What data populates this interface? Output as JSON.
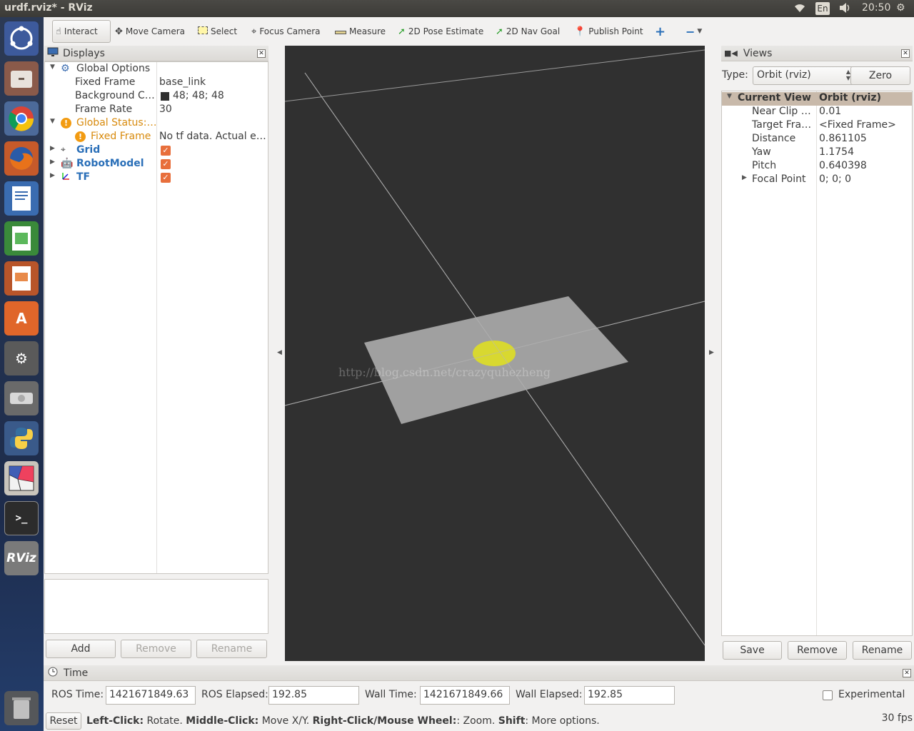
{
  "window": {
    "title": "urdf.rviz* - RViz"
  },
  "system_tray": {
    "language": "En",
    "clock": "20:50"
  },
  "launcher": {
    "items": [
      "ubuntu-logo",
      "files",
      "chrome",
      "firefox",
      "writer",
      "calc",
      "impress",
      "software-center",
      "system-settings",
      "disk",
      "python",
      "app",
      "terminal",
      "rviz",
      "trash"
    ],
    "rviz_label": "RViz"
  },
  "toolbar": {
    "tools": [
      {
        "label": "Interact",
        "icon": "hand-icon"
      },
      {
        "label": "Move Camera",
        "icon": "move-icon"
      },
      {
        "label": "Select",
        "icon": "select-icon"
      },
      {
        "label": "Focus Camera",
        "icon": "focus-icon"
      },
      {
        "label": "Measure",
        "icon": "ruler-icon"
      },
      {
        "label": "2D Pose Estimate",
        "icon": "green-arrow-icon"
      },
      {
        "label": "2D Nav Goal",
        "icon": "green-arrow-icon"
      },
      {
        "label": "Publish Point",
        "icon": "pin-icon"
      }
    ]
  },
  "displays": {
    "title": "Displays",
    "global_options": {
      "label": "Global Options",
      "fixed_frame_label": "Fixed Frame",
      "fixed_frame_value": "base_link",
      "background_label": "Background C…",
      "background_value": "48; 48; 48",
      "frame_rate_label": "Frame Rate",
      "frame_rate_value": "30"
    },
    "global_status": {
      "label": "Global Status:…",
      "fixed_frame_label": "Fixed Frame",
      "fixed_frame_value": "No tf data.  Actual e…"
    },
    "items": [
      {
        "label": "Grid",
        "checked": true
      },
      {
        "label": "RobotModel",
        "checked": true
      },
      {
        "label": "TF",
        "checked": true
      }
    ],
    "buttons": {
      "add": "Add",
      "remove": "Remove",
      "rename": "Rename"
    }
  },
  "viewport": {
    "background_color": "#303030",
    "watermark": "http://blog.csdn.net/crazyquhezheng"
  },
  "views": {
    "title": "Views",
    "type_label": "Type:",
    "type_value": "Orbit (rviz)",
    "zero_button": "Zero",
    "header_name": "Current View",
    "header_value": "Orbit (rviz)",
    "props": [
      {
        "name": "Near Clip …",
        "value": "0.01"
      },
      {
        "name": "Target Fra…",
        "value": "<Fixed Frame>"
      },
      {
        "name": "Distance",
        "value": "0.861105"
      },
      {
        "name": "Yaw",
        "value": "1.1754"
      },
      {
        "name": "Pitch",
        "value": "0.640398"
      },
      {
        "name": "Focal Point",
        "value": "0; 0; 0"
      }
    ],
    "buttons": {
      "save": "Save",
      "remove": "Remove",
      "rename": "Rename"
    }
  },
  "time": {
    "title": "Time",
    "ros_time_label": "ROS Time:",
    "ros_time_value": "1421671849.63",
    "ros_elapsed_label": "ROS Elapsed:",
    "ros_elapsed_value": "192.85",
    "wall_time_label": "Wall Time:",
    "wall_time_value": "1421671849.66",
    "wall_elapsed_label": "Wall Elapsed:",
    "wall_elapsed_value": "192.85",
    "experimental_label": "Experimental"
  },
  "statusbar": {
    "reset": "Reset",
    "hint_parts": [
      {
        "bold": "Left-Click:",
        "text": " Rotate. "
      },
      {
        "bold": "Middle-Click:",
        "text": " Move X/Y. "
      },
      {
        "bold": "Right-Click/Mouse Wheel:",
        "text": ": Zoom. "
      },
      {
        "bold": "Shift",
        "text": ": More options."
      }
    ],
    "fps": "30 fps"
  }
}
